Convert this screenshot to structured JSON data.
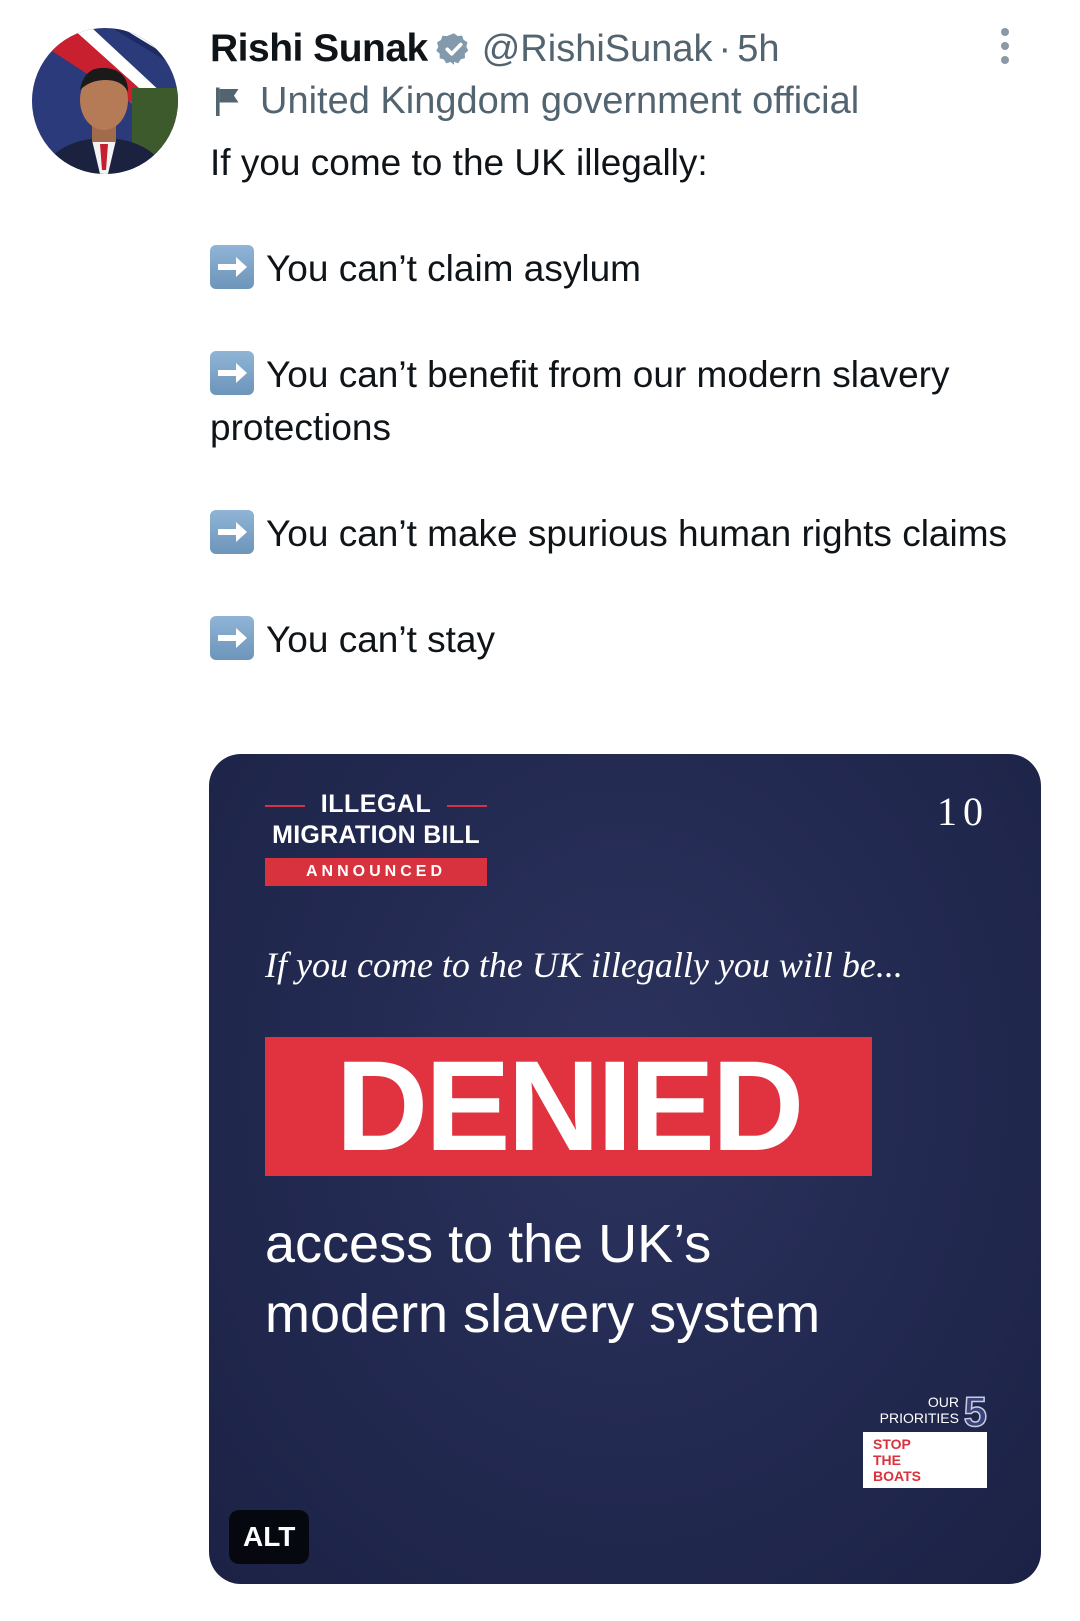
{
  "tweet": {
    "author_name": "Rishi Sunak",
    "handle": "@RishiSunak",
    "separator": "·",
    "time": "5h",
    "label": "United Kingdom government official",
    "text_intro": "If you come to the UK illegally:",
    "points": [
      "You can’t claim asylum",
      "You can’t benefit from our modern slavery protections",
      "You can’t make spurious human rights claims",
      "You can’t stay"
    ]
  },
  "media": {
    "bill_line1": "ILLEGAL",
    "bill_line2": "MIGRATION BILL",
    "bill_status": "ANNOUNCED",
    "logo_text": "10",
    "lead": "If you come to the UK illegally you will be...",
    "headline": "DENIED",
    "sub_line1": "access to the UK’s",
    "sub_line2": "modern slavery system",
    "priorities_our": "OUR",
    "priorities_label": "PRIORITIES",
    "priorities_number": "5",
    "priorities_box": [
      "STOP",
      "THE",
      "BOATS"
    ],
    "alt_label": "ALT"
  },
  "colors": {
    "verified": "#829aab",
    "muted": "#536471",
    "banner_red": "#e0333f",
    "media_navy": "#222950"
  },
  "icons": {
    "verified": "verified-badge-icon",
    "label": "flag-icon",
    "more": "more-options-icon",
    "bullet": "right-arrow-emoji-icon"
  }
}
